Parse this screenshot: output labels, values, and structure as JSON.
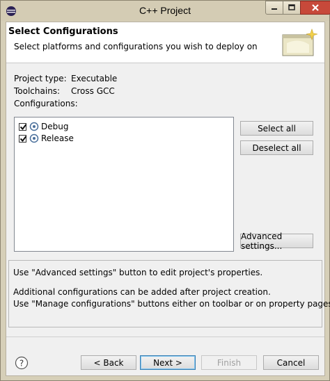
{
  "window": {
    "title": "C++ Project"
  },
  "header": {
    "title": "Select Configurations",
    "description": "Select platforms and configurations you wish to deploy on"
  },
  "project_info": {
    "project_type_label": "Project type:",
    "project_type_value": "Executable",
    "toolchains_label": "Toolchains:",
    "toolchains_value": "Cross GCC",
    "configurations_label": "Configurations:"
  },
  "configurations": [
    {
      "label": "Debug",
      "checked": true
    },
    {
      "label": "Release",
      "checked": true
    }
  ],
  "side_buttons": {
    "select_all": "Select all",
    "deselect_all": "Deselect all",
    "advanced": "Advanced settings..."
  },
  "messages": {
    "line1": "Use \"Advanced settings\" button to edit project's properties.",
    "line2": "Additional configurations can be added after project creation.",
    "line3": "Use \"Manage configurations\" buttons either on toolbar or on property pages."
  },
  "footer": {
    "back": "< Back",
    "next": "Next >",
    "finish": "Finish",
    "cancel": "Cancel"
  }
}
